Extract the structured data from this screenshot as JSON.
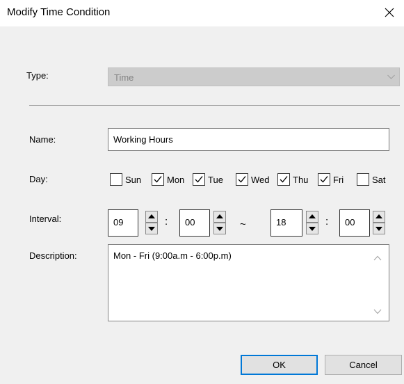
{
  "dialog": {
    "title": "Modify Time Condition"
  },
  "type_field": {
    "label": "Type:",
    "value": "Time"
  },
  "name_field": {
    "label": "Name:",
    "value": "Working Hours"
  },
  "day_field": {
    "label": "Day:",
    "days": [
      {
        "label": "Sun",
        "checked": false
      },
      {
        "label": "Mon",
        "checked": true
      },
      {
        "label": "Tue",
        "checked": true
      },
      {
        "label": "Wed",
        "checked": true
      },
      {
        "label": "Thu",
        "checked": true
      },
      {
        "label": "Fri",
        "checked": true
      },
      {
        "label": "Sat",
        "checked": false
      }
    ]
  },
  "interval_field": {
    "label": "Interval:",
    "start_hour": "09",
    "start_minute": "00",
    "end_hour": "18",
    "end_minute": "00",
    "time_separator": ":",
    "range_separator": "~"
  },
  "description_field": {
    "label": "Description:",
    "value": "Mon - Fri (9:00a.m - 6:00p.m)"
  },
  "buttons": {
    "ok_label": "OK",
    "cancel_label": "Cancel"
  },
  "icons": {
    "close": "close-icon",
    "dropdown": "chevron-down-icon",
    "spin_up": "arrow-up-icon",
    "spin_down": "arrow-down-icon",
    "check": "checkmark-icon"
  },
  "colors": {
    "accent": "#0078d7",
    "dialog_background": "#f0f0f0",
    "disabled_combo": "#cccccc"
  }
}
